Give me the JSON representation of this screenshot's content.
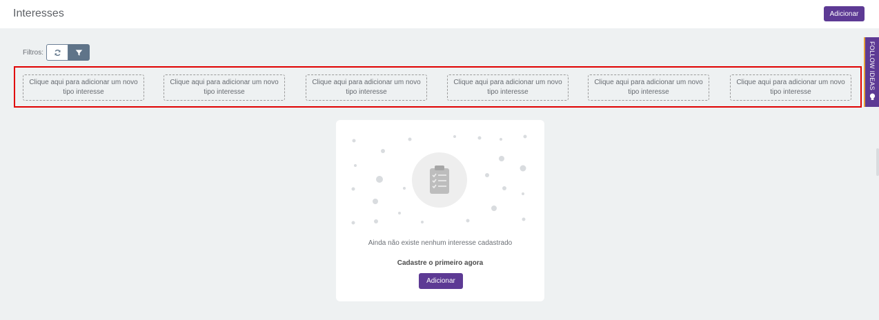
{
  "header": {
    "title": "Interesses",
    "add_label": "Adicionar"
  },
  "filters": {
    "label": "Filtros:",
    "refresh_icon": "refresh-icon",
    "filter_icon": "funnel-icon"
  },
  "type_cards": [
    {
      "label": "Clique aqui para adicionar um novo tipo interesse"
    },
    {
      "label": "Clique aqui para adicionar um novo tipo interesse"
    },
    {
      "label": "Clique aqui para adicionar um novo tipo interesse"
    },
    {
      "label": "Clique aqui para adicionar um novo tipo interesse"
    },
    {
      "label": "Clique aqui para adicionar um novo tipo interesse"
    },
    {
      "label": "Clique aqui para adicionar um novo tipo interesse"
    }
  ],
  "side_tab": {
    "label": "FOLLOW IDEAS",
    "icon": "lightbulb-icon"
  },
  "empty_state": {
    "icon": "clipboard-checklist-icon",
    "message": "Ainda não existe nenhum interesse cadastrado",
    "cta": "Cadastre o primeiro agora",
    "add_label": "Adicionar"
  },
  "colors": {
    "accent": "#5d3a94",
    "highlight": "#e00000",
    "background": "#eef1f2"
  }
}
